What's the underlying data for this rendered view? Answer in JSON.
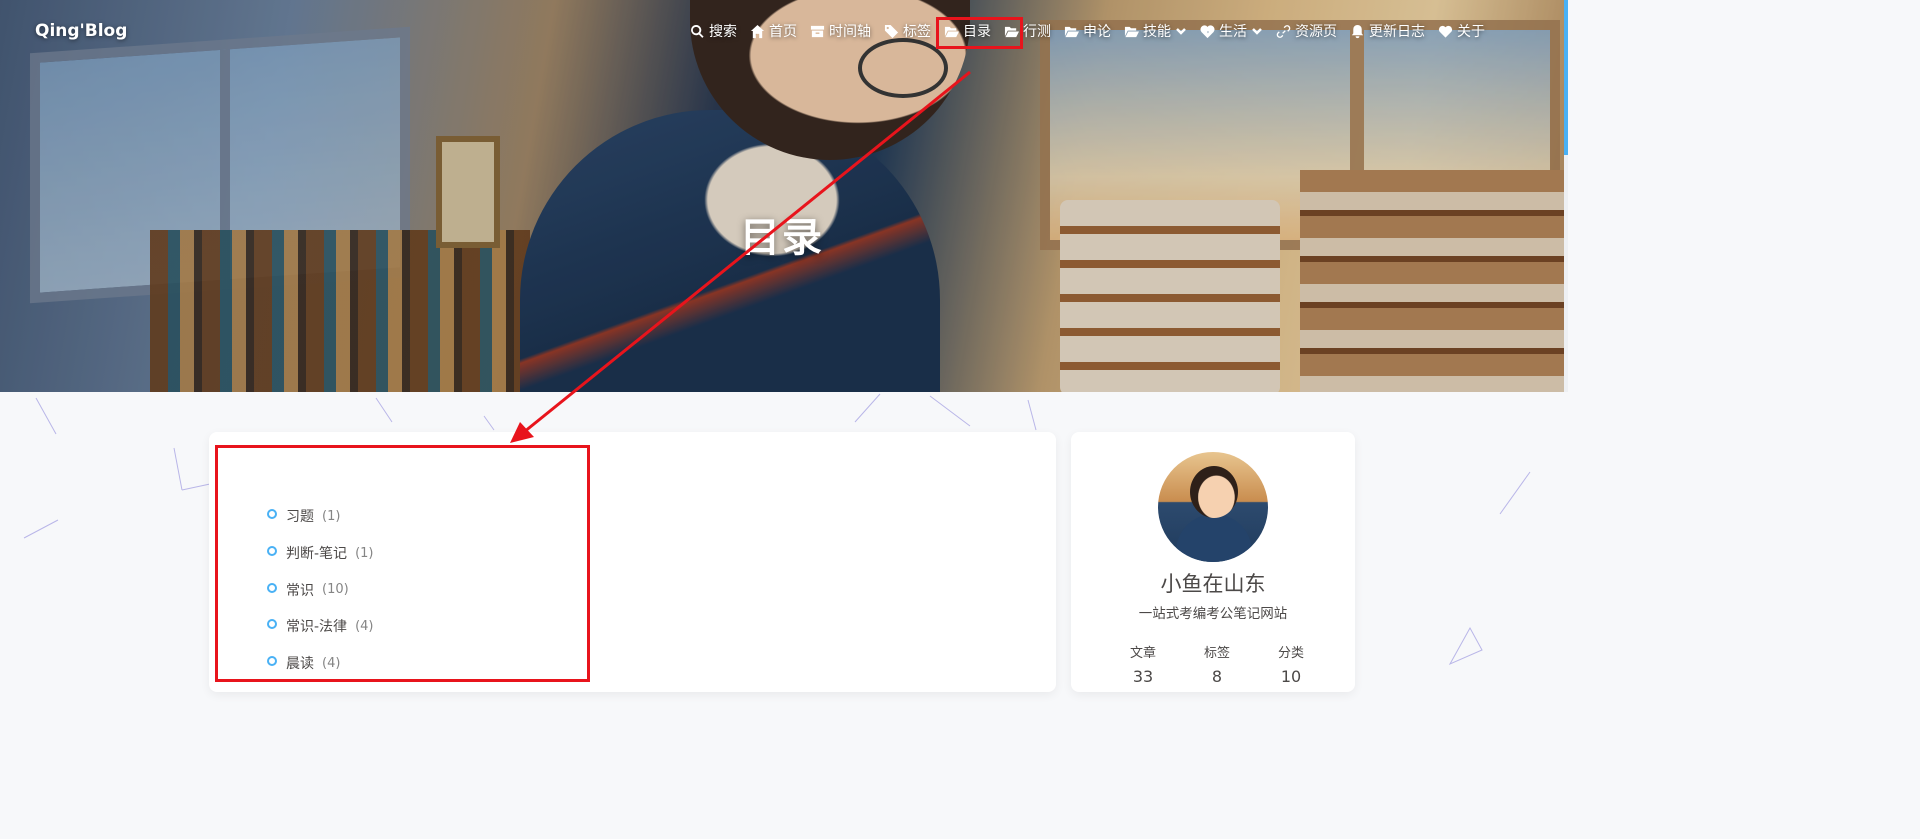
{
  "site": {
    "brand": "Qing'Blog"
  },
  "nav": {
    "items": [
      {
        "label": "搜索",
        "icon": "search-icon"
      },
      {
        "label": "首页",
        "icon": "home-icon"
      },
      {
        "label": "时间轴",
        "icon": "archive-icon"
      },
      {
        "label": "标签",
        "icon": "tags-icon"
      },
      {
        "label": "目录",
        "icon": "folder-open-icon"
      },
      {
        "label": "行测",
        "icon": "folder-open-icon"
      },
      {
        "label": "申论",
        "icon": "folder-open-icon"
      },
      {
        "label": "技能",
        "icon": "folder-open-icon",
        "dropdown": true
      },
      {
        "label": "生活",
        "icon": "heartbeat-icon",
        "dropdown": true
      },
      {
        "label": "资源页",
        "icon": "link-icon"
      },
      {
        "label": "更新日志",
        "icon": "bell-icon"
      },
      {
        "label": "关于",
        "icon": "heart-icon"
      }
    ]
  },
  "hero": {
    "title": "目录"
  },
  "categories": [
    {
      "name": "习题",
      "count": "(1)"
    },
    {
      "name": "判断-笔记",
      "count": "(1)"
    },
    {
      "name": "常识",
      "count": "(10)"
    },
    {
      "name": "常识-法律",
      "count": "(4)"
    },
    {
      "name": "晨读",
      "count": "(4)"
    }
  ],
  "author": {
    "name": "小鱼在山东",
    "description": "一站式考编考公笔记网站",
    "stats": [
      {
        "label": "文章",
        "value": "33"
      },
      {
        "label": "标签",
        "value": "8"
      },
      {
        "label": "分类",
        "value": "10"
      }
    ]
  },
  "colors": {
    "accent": "#49b1f5",
    "annotation": "#e8141c",
    "text": "#4c4948"
  }
}
